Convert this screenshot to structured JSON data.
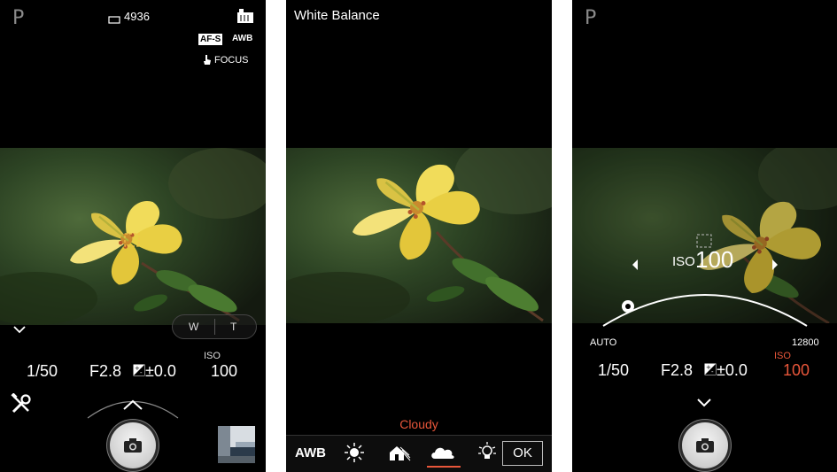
{
  "screen1": {
    "mode": "P",
    "shots_remaining": "4936",
    "focus_mode_badge": "AF-S",
    "wb_badge": "AWB",
    "focus_label": "FOCUS",
    "zoom_w": "W",
    "zoom_t": "T",
    "shutter_speed": "1/50",
    "aperture": "F2.8",
    "exposure_comp": "±0.0",
    "iso_label": "ISO",
    "iso_value": "100"
  },
  "screen2": {
    "title": "White Balance",
    "selected_preset": "Cloudy",
    "presets": [
      "AWB",
      "sun-icon",
      "shade-icon",
      "cloud-icon",
      "incandescent-icon"
    ],
    "ok_label": "OK"
  },
  "screen3": {
    "mode": "P",
    "iso_label": "ISO",
    "iso_value": "100",
    "dial_min": "AUTO",
    "dial_max": "12800",
    "dial_position": 0.05,
    "shutter_speed": "1/50",
    "aperture": "F2.8",
    "exposure_comp": "±0.0",
    "iso_small_label": "ISO",
    "iso_small_value": "100"
  },
  "colors": {
    "accent_orange": "#e8563a",
    "background": "#000000"
  }
}
